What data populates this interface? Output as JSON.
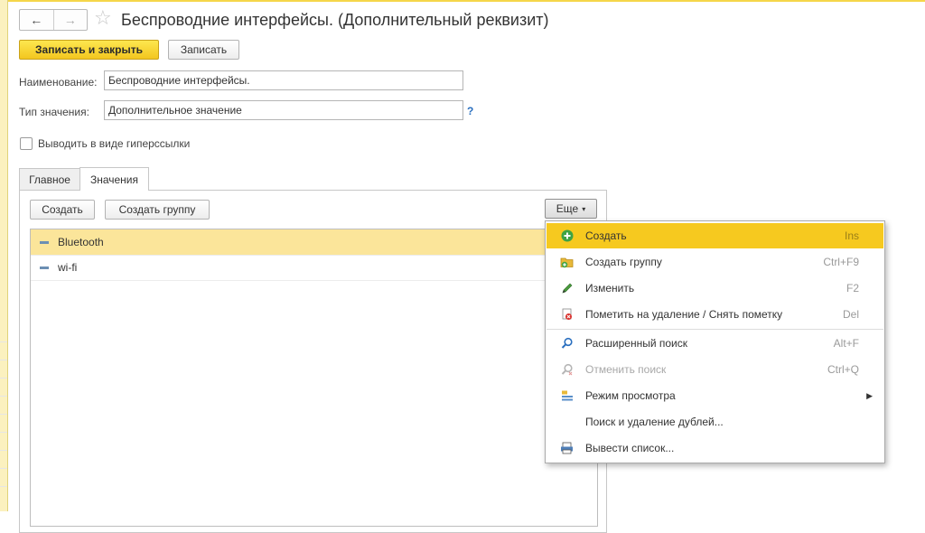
{
  "header": {
    "title": "Беспроводние интерфейсы. (Дополнительный реквизит)",
    "back_glyph": "←",
    "forward_glyph": "→",
    "star_glyph": "☆"
  },
  "toolbar": {
    "save_close_label": "Записать и закрыть",
    "save_label": "Записать"
  },
  "form": {
    "name_label": "Наименование:",
    "name_value": "Беспроводние интерфейсы.",
    "type_label": "Тип значения:",
    "type_value": "Дополнительное значение",
    "help_glyph": "?",
    "hyperlink_label": "Выводить в виде гиперссылки"
  },
  "tabs": [
    {
      "label": "Главное"
    },
    {
      "label": "Значения"
    }
  ],
  "values_panel": {
    "create_label": "Создать",
    "create_group_label": "Создать группу",
    "more_label": "Еще",
    "caret": "▾"
  },
  "list": {
    "items": [
      {
        "label": "Bluetooth"
      },
      {
        "label": "wi-fi"
      }
    ]
  },
  "menu": {
    "items": [
      {
        "label": "Создать",
        "shortcut": "Ins",
        "icon": "plus-circle-icon"
      },
      {
        "label": "Создать группу",
        "shortcut": "Ctrl+F9",
        "icon": "folder-add-icon"
      },
      {
        "label": "Изменить",
        "shortcut": "F2",
        "icon": "pencil-icon"
      },
      {
        "label": "Пометить на удаление / Снять пометку",
        "shortcut": "Del",
        "icon": "delete-mark-icon"
      },
      {
        "label": "Расширенный поиск",
        "shortcut": "Alt+F",
        "icon": "search-icon"
      },
      {
        "label": "Отменить поиск",
        "shortcut": "Ctrl+Q",
        "icon": "cancel-search-icon"
      },
      {
        "label": "Режим просмотра",
        "shortcut": "",
        "icon": "view-mode-icon"
      },
      {
        "label": "Поиск и удаление дублей...",
        "shortcut": "",
        "icon": ""
      },
      {
        "label": "Вывести список...",
        "shortcut": "",
        "icon": "list-output-icon"
      }
    ],
    "submenu_glyph": "▶"
  },
  "colors": {
    "accent_yellow": "#f6c91f",
    "selection_row": "#fbe59a",
    "help_blue": "#2a6fbf"
  }
}
